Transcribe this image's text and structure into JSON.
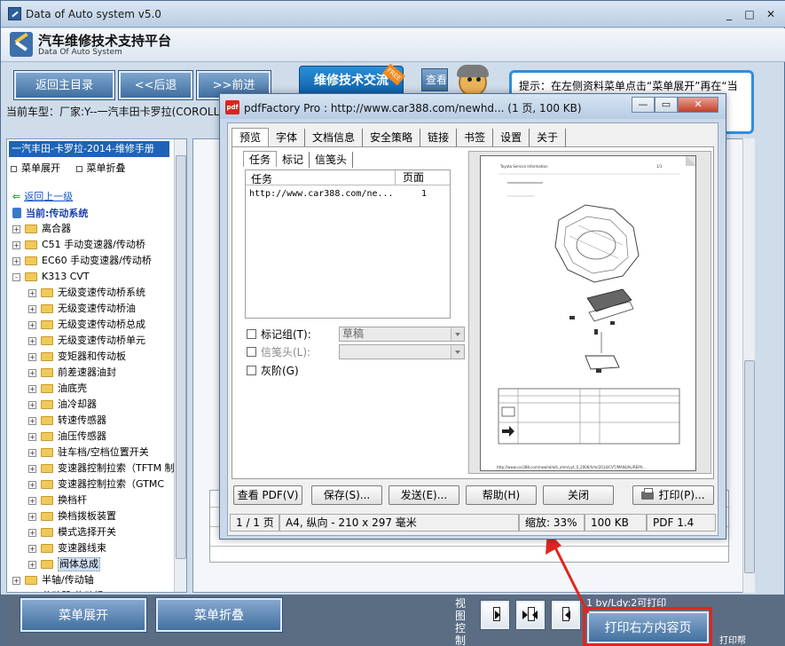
{
  "window": {
    "title": "Data of Auto system v5.0",
    "controls": [
      "_",
      "□",
      "✕"
    ]
  },
  "header": {
    "title": "汽车维修技术支持平台",
    "subtitle": "Data Of Auto System"
  },
  "toolbar": {
    "home": "返回主目录",
    "back": "<<后退",
    "forward": ">>前进",
    "forum": "维修技术交流",
    "forum_badge": "FREE",
    "search": "查看"
  },
  "tip": {
    "text": "提示：在左侧资料菜单点击“菜单展开”再在“当前车型”中输入关键"
  },
  "car_line": "当前车型：厂家:Y--一汽丰田卡罗拉(COROLLA",
  "tree": {
    "header": "一汽丰田-卡罗拉-2014-维修手册",
    "expand": "菜单展开",
    "collapse": "菜单折叠",
    "back_up": "返回上一级",
    "current": "当前:传动系统",
    "items": [
      {
        "label": "离合器",
        "level": 0,
        "pm": "+"
      },
      {
        "label": "C51 手动变速器/传动桥",
        "level": 0,
        "pm": "+"
      },
      {
        "label": "EC60 手动变速器/传动桥",
        "level": 0,
        "pm": "+"
      },
      {
        "label": "K313 CVT",
        "level": 0,
        "pm": "-"
      },
      {
        "label": "无级变速传动桥系统",
        "level": 1,
        "pm": "+"
      },
      {
        "label": "无级变速传动桥油",
        "level": 1,
        "pm": "+"
      },
      {
        "label": "无级变速传动桥总成",
        "level": 1,
        "pm": "+"
      },
      {
        "label": "无级变速传动桥单元",
        "level": 1,
        "pm": "+"
      },
      {
        "label": "变矩器和传动板",
        "level": 1,
        "pm": "+"
      },
      {
        "label": "前差速器油封",
        "level": 1,
        "pm": "+"
      },
      {
        "label": "油底壳",
        "level": 1,
        "pm": "+"
      },
      {
        "label": "油冷却器",
        "level": 1,
        "pm": "+"
      },
      {
        "label": "转速传感器",
        "level": 1,
        "pm": "+"
      },
      {
        "label": "油压传感器",
        "level": 1,
        "pm": "+"
      },
      {
        "label": "驻车档/空档位置开关",
        "level": 1,
        "pm": "+"
      },
      {
        "label": "变速器控制拉索（TFTM 制",
        "level": 1,
        "pm": "+"
      },
      {
        "label": "变速器控制拉索（GTMC",
        "level": 1,
        "pm": "+"
      },
      {
        "label": "换档杆",
        "level": 1,
        "pm": "+"
      },
      {
        "label": "换档拨板装置",
        "level": 1,
        "pm": "+"
      },
      {
        "label": "模式选择开关",
        "level": 1,
        "pm": "+"
      },
      {
        "label": "变速器线束",
        "level": 1,
        "pm": "+"
      },
      {
        "label": "阀体总成",
        "level": 1,
        "pm": "+",
        "selected": true
      },
      {
        "label": "半轴/传动轴",
        "level": 0,
        "pm": "+"
      },
      {
        "label": "分动器/传动桥",
        "level": 0,
        "pm": "+"
      }
    ]
  },
  "dialog": {
    "title": "pdfFactory Pro : http://www.car388.com/newhd... (1 页, 100 KB)",
    "controls": [
      "—",
      "▭",
      "✕"
    ],
    "tabs": [
      "预览",
      "字体",
      "文档信息",
      "安全策略",
      "链接",
      "书签",
      "设置",
      "关于"
    ],
    "subtabs": [
      "任务",
      "标记",
      "信笺头"
    ],
    "job_table": {
      "headers": [
        "任务",
        "页面"
      ],
      "rows": [
        [
          "http://www.car388.com/ne...",
          "1"
        ]
      ]
    },
    "options": {
      "mark_group": "标记组(T):",
      "mark_group_value": "草稿",
      "letterhead": "信笺头(L):",
      "letterhead_value": "",
      "grayscale": "灰阶(G)"
    },
    "buttons": {
      "view_pdf": "查看 PDF(V)",
      "save": "保存(S)...",
      "send": "发送(E)...",
      "help": "帮助(H)",
      "close": "关闭",
      "print": "打印(P)..."
    },
    "status": {
      "page": "1 / 1 页",
      "paper": "A4, 纵向 - 210 x 297 毫米",
      "zoom": "缩放: 33%",
      "size": "100 KB",
      "pdf_version": "PDF 1.4"
    },
    "preview_texts": {
      "header_left": "Toyota Service Information",
      "header_right": "1/1",
      "footer": "http://www.car388.com/newhd/olit_ahm/yyt_0_2006/h/m/2014/CVT/MANUAL/REPA..."
    }
  },
  "bottom": {
    "expand": "菜单展开",
    "collapse": "菜单折叠",
    "view_label": "视图控制",
    "page_hint": "1 by/Ldy:2可打印",
    "print_right": "打印右方内容页",
    "print_help": "打印帮"
  },
  "colors": {
    "accent_blue": "#1e63b6",
    "highlight_red": "#e0251f",
    "dialog_bg": "#cad9ea"
  }
}
